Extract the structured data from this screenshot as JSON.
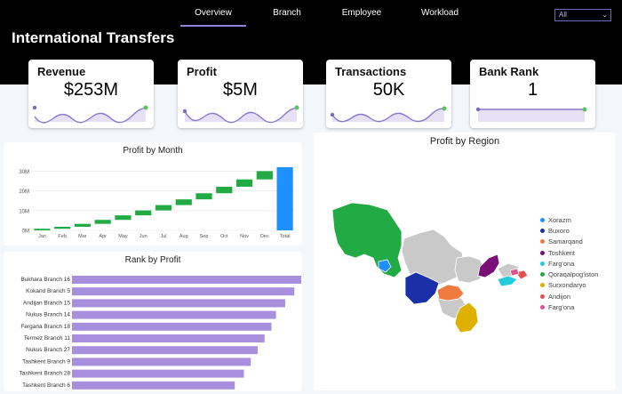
{
  "header": {
    "title": "International Transfers",
    "tabs": [
      {
        "label": "Overview",
        "active": true
      },
      {
        "label": "Branch",
        "active": false
      },
      {
        "label": "Employee",
        "active": false
      },
      {
        "label": "Workload",
        "active": false
      }
    ],
    "filter": {
      "value": "All"
    }
  },
  "kpis": [
    {
      "label": "Revenue",
      "value": "$253M"
    },
    {
      "label": "Profit",
      "value": "$5M"
    },
    {
      "label": "Transactions",
      "value": "50K"
    },
    {
      "label": "Bank Rank",
      "value": "1"
    }
  ],
  "colors": {
    "accent": "#8f7fd6",
    "spark_line": "#8a78cf",
    "spark_fill": "#e6e0f5",
    "spark_start": "#7a68c2",
    "spark_end": "#5cc45c",
    "waterfall_increase": "#22aa44",
    "waterfall_total": "#1e90ff",
    "bar": "#a88fdd"
  },
  "panels": {
    "profit_by_month": {
      "title": "Profit by Month"
    },
    "rank_by_profit": {
      "title": "Rank by Profit"
    },
    "profit_by_region": {
      "title": "Profit by Region"
    }
  },
  "chart_data": [
    {
      "type": "bar",
      "subtype": "waterfall",
      "title": "Profit by Month",
      "categories": [
        "Jan",
        "Feb",
        "Mar",
        "Apr",
        "May",
        "Jun",
        "Jul",
        "Aug",
        "Sep",
        "Oct",
        "Nov",
        "Dec",
        "Total"
      ],
      "values": [
        0.8,
        1.0,
        1.5,
        2.0,
        2.3,
        2.5,
        2.7,
        2.9,
        3.1,
        3.3,
        3.7,
        4.2,
        32.0
      ],
      "y_ticks": [
        "0M",
        "10M",
        "20M",
        "30M"
      ],
      "ylim": [
        0,
        34
      ]
    },
    {
      "type": "bar",
      "orientation": "horizontal",
      "title": "Rank by Profit",
      "categories": [
        "Bukhara Branch 16",
        "Kokand Branch 5",
        "Andijan Branch 15",
        "Nukus Branch 14",
        "Fergana Branch 18",
        "Termez Branch 11",
        "Nukus Branch 27",
        "Tashkent Branch 9",
        "Tashkent Branch 28",
        "Tashkent Branch 6"
      ],
      "values": [
        100,
        97,
        93,
        89,
        87,
        84,
        81,
        78,
        75,
        71
      ]
    }
  ],
  "region_legend": [
    {
      "name": "Xorazm",
      "color": "#1e90ff"
    },
    {
      "name": "Buxoro",
      "color": "#1a2fa8"
    },
    {
      "name": "Samarqand",
      "color": "#f07b3f"
    },
    {
      "name": "Toshkent",
      "color": "#7a0f7a"
    },
    {
      "name": "Farg'ona",
      "color": "#22ccdd"
    },
    {
      "name": "Qoraqalpog'iston",
      "color": "#22aa44"
    },
    {
      "name": "Surxondaryo",
      "color": "#e0b000"
    },
    {
      "name": "Andijon",
      "color": "#e05050"
    },
    {
      "name": "Farg'ona",
      "color": "#e0508a"
    }
  ]
}
